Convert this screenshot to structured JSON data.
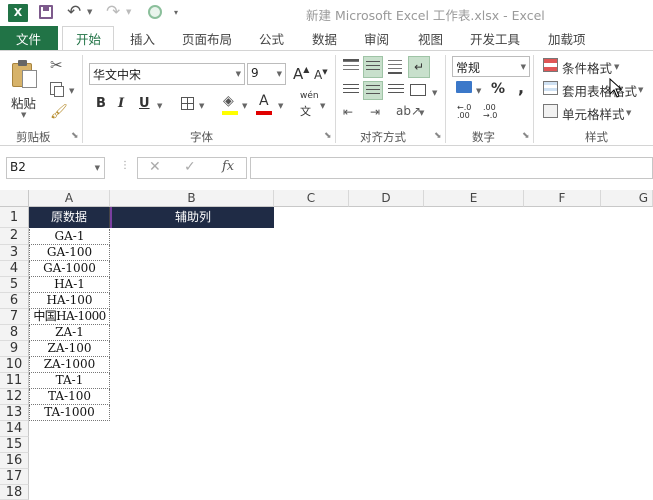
{
  "window": {
    "title": "新建 Microsoft Excel 工作表.xlsx - Excel"
  },
  "tabs": [
    "文件",
    "开始",
    "插入",
    "页面布局",
    "公式",
    "数据",
    "审阅",
    "视图",
    "开发工具",
    "加载项"
  ],
  "active_tab": "开始",
  "ribbon": {
    "clipboard": {
      "paste_label": "粘贴",
      "group_label": "剪贴板"
    },
    "font": {
      "font_name": "华文中宋",
      "font_size": "9",
      "wen": "wén",
      "group_label": "字体"
    },
    "alignment": {
      "group_label": "对齐方式"
    },
    "number": {
      "format": "常规",
      "percent": "%",
      "comma": ",",
      "group_label": "数字"
    },
    "styles": {
      "cond_format": "条件格式",
      "table_format": "套用表格格式",
      "cell_style": "单元格样式",
      "group_label": "样式"
    }
  },
  "formula_bar": {
    "name_box": "B2",
    "fx": "fx",
    "value": ""
  },
  "columns": [
    "A",
    "B",
    "C",
    "D",
    "E",
    "F",
    "G"
  ],
  "rows": [
    "1",
    "2",
    "3",
    "4",
    "5",
    "6",
    "7",
    "8",
    "9",
    "10",
    "11",
    "12",
    "13",
    "14",
    "15",
    "16",
    "17",
    "18"
  ],
  "sheet": {
    "header_a": "原数据",
    "header_b": "辅助列",
    "header_fill": "#1f2b45",
    "data": [
      "GA-1",
      "GA-100",
      "GA-1000",
      "HA-1",
      "HA-100",
      "中国HA-1000",
      "ZA-1",
      "ZA-100",
      "ZA-1000",
      "TA-1",
      "TA-100",
      "TA-1000"
    ]
  },
  "colors": {
    "excel_green": "#217346",
    "selected_header": "#1f2b45",
    "selection_border": "#7a3fa0"
  }
}
